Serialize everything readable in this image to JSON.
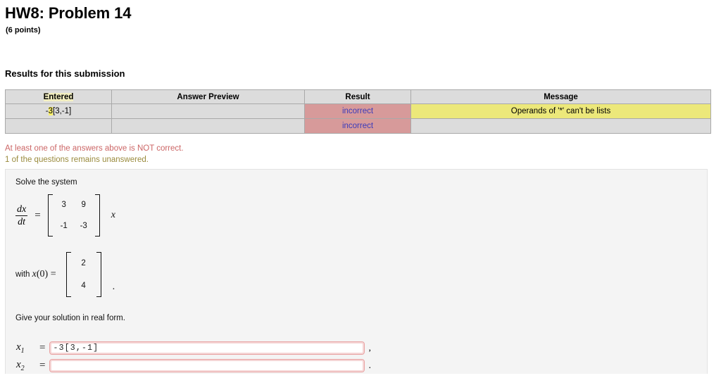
{
  "header": {
    "title": "HW8: Problem 14",
    "points": "(6 points)"
  },
  "results": {
    "heading": "Results for this submission",
    "columns": [
      "Entered",
      "Answer Preview",
      "Result",
      "Message"
    ],
    "rows": [
      {
        "entered_prefix": "-",
        "entered_highlight": "3",
        "entered_suffix": "[3,-1]",
        "entered_full": "-3[3,-1]",
        "answer_preview": "",
        "result": "incorrect",
        "message": "Operands of '*' can't be lists"
      },
      {
        "entered_prefix": "",
        "entered_highlight": "",
        "entered_suffix": "",
        "entered_full": "",
        "answer_preview": "",
        "result": "incorrect",
        "message": ""
      }
    ]
  },
  "status": {
    "incorrect_note": "At least one of the answers above is NOT correct.",
    "unanswered_note": "1 of the questions remains unanswered."
  },
  "problem": {
    "prompt": "Solve the system",
    "derivative_numerator": "dx",
    "derivative_denominator": "dt",
    "equals": "=",
    "matrix": [
      [
        "3",
        "9"
      ],
      [
        "-1",
        "-3"
      ]
    ],
    "state_variable": "x",
    "initial_condition_label": "with",
    "initial_condition_symbol": "x",
    "initial_condition_arg": "(0) =",
    "initial_vector": [
      "2",
      "4"
    ],
    "initial_trailing_punct": ".",
    "instruction": "Give your solution in real form."
  },
  "answers": {
    "fields": [
      {
        "label": "x",
        "subscript": "1",
        "equals": "=",
        "value": "-3[3,-1]",
        "placeholder": "",
        "trailing_punct": ","
      },
      {
        "label": "x",
        "subscript": "2",
        "equals": "=",
        "value": "",
        "placeholder": "",
        "trailing_punct": "."
      }
    ]
  },
  "colors": {
    "incorrect_cell_bg": "#d79a9a",
    "incorrect_text": "#3b3bbb",
    "message_warning_bg": "#ece87a",
    "header_cell_bg": "#dcdcdc",
    "status_error_text": "#cc6666",
    "status_warning_text": "#9a8b3d",
    "input_border": "#e9a3a3",
    "panel_bg": "#f4f4f4",
    "highlight_yellow": "#fbf06a"
  }
}
